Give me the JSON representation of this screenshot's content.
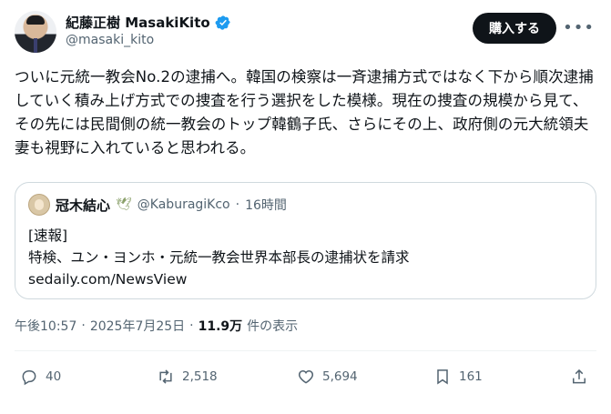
{
  "author": {
    "display_name": "紀藤正樹 MasakiKito",
    "handle": "@masaki_kito",
    "verified_color": "#1d9bf0"
  },
  "buttons": {
    "subscribe": "購入する"
  },
  "post": {
    "text": "ついに元統一教会No.2の逮捕へ。韓国の検察は一斉逮捕方式ではなく下から順次逮捕していく積み上げ方式での捜査を行う選択をした模様。現在の捜査の規模から見て、その先には民間側の統一教会のトップ韓鶴子氏、さらにその上、政府側の元大統領夫妻も視野に入れていると思われる。"
  },
  "quote": {
    "display_name": "冠木結心",
    "badge": "🕊",
    "handle": "@KaburagiKco",
    "separator": "·",
    "time": "16時間",
    "lines": [
      "[速報]",
      "特検、ユン・ヨンホ・元統一教会世界本部長の逮捕状を請求",
      "sedaily.com/NewsView"
    ]
  },
  "meta": {
    "time": "午後10:57",
    "dot": "·",
    "date": "2025年7月25日",
    "dot2": "·",
    "views": "11.9万",
    "views_label": "件の表示"
  },
  "actions": {
    "reply": "40",
    "retweet": "2,518",
    "like": "5,694",
    "bookmark": "161"
  },
  "icons": [
    "comment-icon",
    "retweet-icon",
    "heart-icon",
    "bookmark-icon",
    "share-icon",
    "more-icon",
    "verified-icon"
  ]
}
